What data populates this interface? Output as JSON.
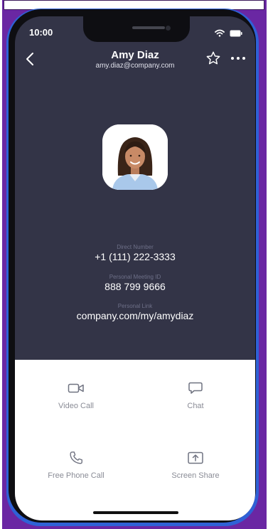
{
  "status_bar": {
    "time": "10:00"
  },
  "contact": {
    "name": "Amy Diaz",
    "email": "amy.diaz@company.com"
  },
  "info": [
    {
      "label": "Direct Number",
      "value": "+1 (111) 222-3333"
    },
    {
      "label": "Personal Meeting ID",
      "value": "888 799 9666"
    },
    {
      "label": "Personal Link",
      "value": "company.com/my/amydiaz"
    }
  ],
  "actions": {
    "video_call": "Video Call",
    "chat": "Chat",
    "free_phone_call": "Free Phone Call",
    "screen_share": "Screen Share"
  },
  "icons": [
    "back-chevron-icon",
    "star-icon",
    "more-icon",
    "video-camera-icon",
    "chat-bubble-icon",
    "phone-icon",
    "screen-share-icon",
    "wifi-icon",
    "battery-icon"
  ],
  "colors": {
    "screen_bg": "#333447",
    "frame": "#6a27a3",
    "blue_band": "#2f61d6",
    "action_text": "#8a8c96"
  }
}
